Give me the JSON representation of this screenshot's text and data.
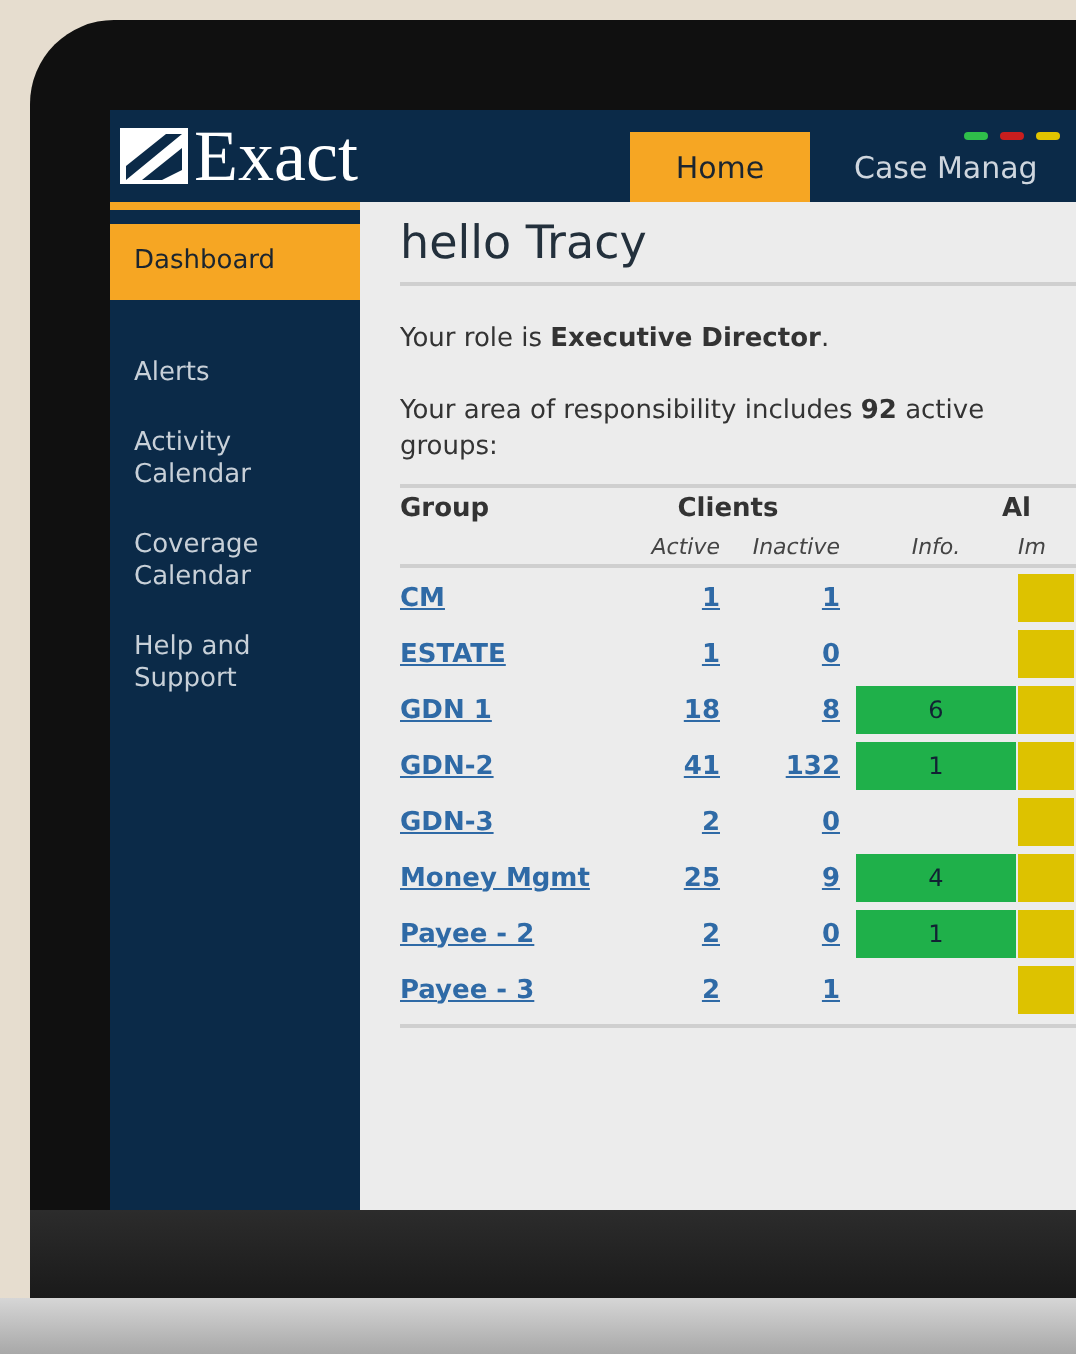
{
  "header": {
    "logo": "Exact",
    "tabs": [
      {
        "label": "Home",
        "selected": true
      },
      {
        "label": "Case Manag",
        "selected": false
      }
    ],
    "indicators": [
      {
        "color": "#2fbf4a"
      },
      {
        "color": "#c81e1e"
      },
      {
        "color": "#e0c400"
      }
    ]
  },
  "sidebar": {
    "items": [
      {
        "label": "Dashboard",
        "selected": true
      },
      {
        "label": "Alerts",
        "selected": false
      },
      {
        "label": "Activity Calendar",
        "selected": false
      },
      {
        "label": "Coverage Calendar",
        "selected": false
      },
      {
        "label": "Help and Support",
        "selected": false
      }
    ]
  },
  "main": {
    "title": "hello Tracy",
    "role_text": "Your role is **Executive Director**.",
    "area_text": [
      "Your area of responsibility includes **92** active",
      "groups:"
    ],
    "table": {
      "columns": [
        "Group",
        "Clients",
        "Al"
      ],
      "subcolumns": [
        "Active",
        "Inactive",
        "Info.",
        "Im"
      ],
      "rows": [
        {
          "group": "CM",
          "active": "1",
          "inactive": "1"
        },
        {
          "group": "ESTATE",
          "active": "1",
          "inactive": "0"
        },
        {
          "group": "GDN 1",
          "active": "18",
          "inactive": "8",
          "info": "6"
        },
        {
          "group": "GDN-2",
          "active": "41",
          "inactive": "132",
          "info": "1"
        },
        {
          "group": "GDN-3",
          "active": "2",
          "inactive": "0"
        },
        {
          "group": "Money Mgmt",
          "active": "25",
          "inactive": "9",
          "info": "4"
        },
        {
          "group": "Payee - 2",
          "active": "2",
          "inactive": "0",
          "info": "1"
        },
        {
          "group": "Payee - 3",
          "active": "2",
          "inactive": "1"
        }
      ]
    }
  }
}
